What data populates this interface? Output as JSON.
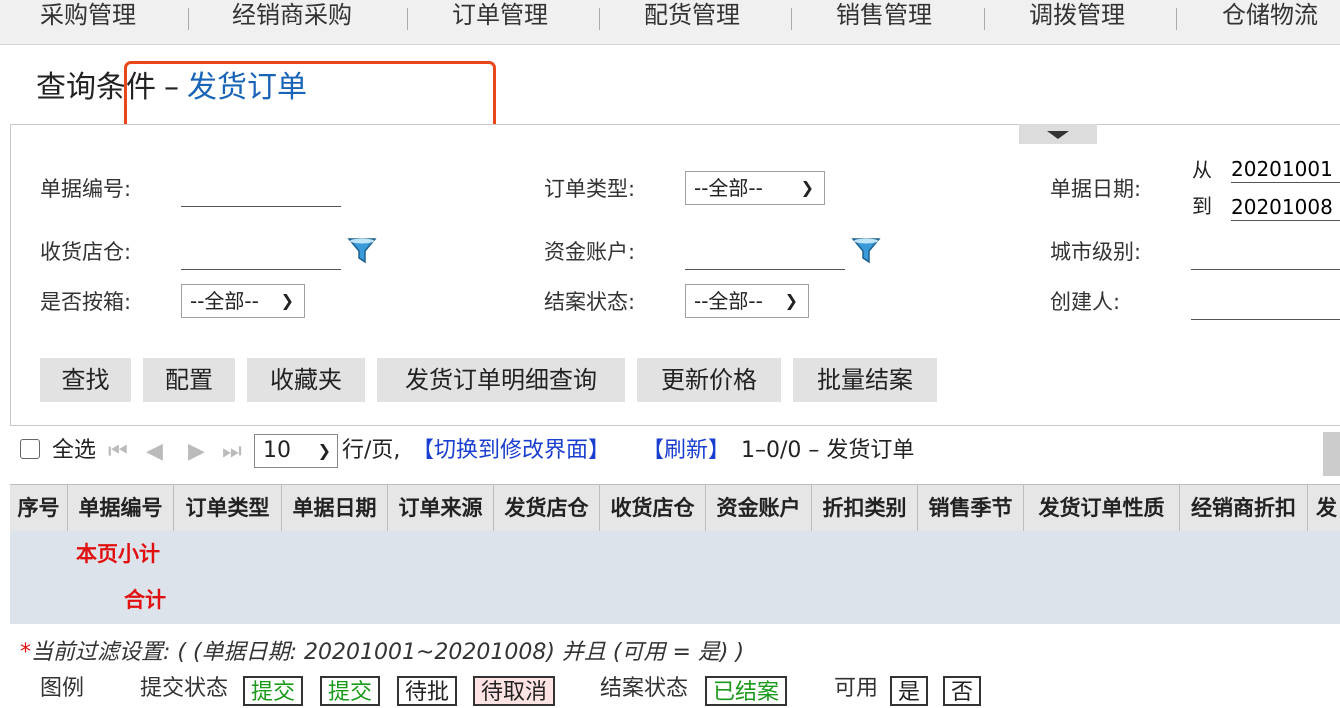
{
  "nav": [
    "采购管理",
    "经销商采购",
    "订单管理",
    "配货管理",
    "销售管理",
    "调拨管理",
    "仓储物流"
  ],
  "title": {
    "prefix": "查询条件",
    "dash": "–",
    "name": "发货订单"
  },
  "form": {
    "doc_no_label": "单据编号:",
    "order_type_label": "订单类型:",
    "order_type_value": "--全部--",
    "doc_date_label": "单据日期:",
    "date_from_label": "从",
    "date_from": "20201001",
    "date_to_label": "到",
    "date_to": "20201008",
    "receive_store_label": "收货店仓:",
    "fund_account_label": "资金账户:",
    "city_level_label": "城市级别:",
    "by_box_label": "是否按箱:",
    "by_box_value": "--全部--",
    "close_status_label": "结案状态:",
    "close_status_value": "--全部--",
    "creator_label": "创建人:"
  },
  "buttons": [
    "查找",
    "配置",
    "收藏夹",
    "发货订单明细查询",
    "更新价格",
    "批量结案"
  ],
  "pager": {
    "select_all": "全选",
    "per_page": "10",
    "per_page_suffix": "行/页,",
    "switch_link": "【切换到修改界面】",
    "refresh_link": "【刷新】",
    "range": "1–0/0 – 发货订单"
  },
  "columns": [
    "序号",
    "单据编号",
    "订单类型",
    "单据日期",
    "订单来源",
    "发货店仓",
    "收货店仓",
    "资金账户",
    "折扣类别",
    "销售季节",
    "发货订单性质",
    "经销商折扣",
    "发"
  ],
  "summary": {
    "page_subtotal": "本页小计",
    "total": "合计"
  },
  "filter_note": {
    "star": "*",
    "text": "当前过滤设置: ( (单据日期: 20201001~20201008) 并且 (可用 = 是) )"
  },
  "legend": {
    "label": "图例",
    "submit_label": "提交状态",
    "submit_a": "提交",
    "submit_b": "提交",
    "pending": "待批",
    "cancel": "待取消",
    "close_label": "结案状态",
    "closed": "已结案",
    "avail_label": "可用",
    "yes": "是",
    "no": "否"
  },
  "colors": {
    "accent_blue": "#1a64b8",
    "link_blue": "#1a3fd0",
    "red": "#e01010",
    "annotation_orange": "#e9461a"
  }
}
